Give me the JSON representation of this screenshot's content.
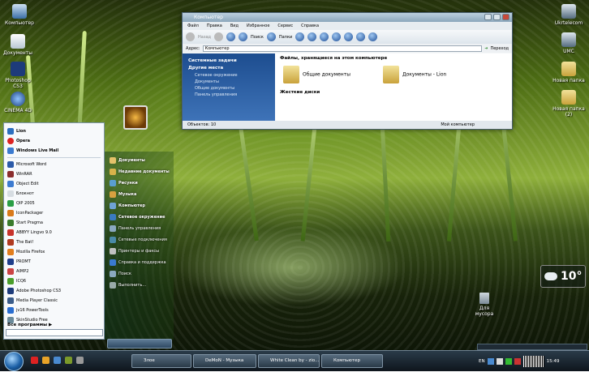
{
  "desktop": {
    "icons_left": [
      {
        "label": "Компьютер"
      },
      {
        "label": "Документы"
      },
      {
        "label": "Photoshop CS3"
      },
      {
        "label": "CINEMA 4D"
      }
    ],
    "icons_right": [
      {
        "label": "Ukrtelecom"
      },
      {
        "label": "UMC"
      },
      {
        "label": "Новая папка"
      },
      {
        "label": "Новая папка (2)"
      }
    ],
    "trash": "Для мусора"
  },
  "window": {
    "title": "Компьютер",
    "menu": [
      "Файл",
      "Правка",
      "Вид",
      "Избранное",
      "Сервис",
      "Справка"
    ],
    "toolbar": {
      "back": "Назад",
      "search": "Поиск",
      "folders": "Папки"
    },
    "address_label": "Адрес:",
    "address_value": "Компьютер",
    "go": "Переход",
    "tasks_system": "Системные задачи",
    "tasks_other": "Другие места",
    "other_places": [
      "Сетевое окружение",
      "Документы",
      "Общие документы",
      "Панель управления"
    ],
    "files_heading": "Файлы, хранящиеся на этом компьютере",
    "folders": [
      "Общие документы",
      "Документы - Lion"
    ],
    "drives_heading": "Жесткие диски",
    "status_left": "Объектов: 10",
    "status_right": "Мой компьютер"
  },
  "start_menu": {
    "pinned": [
      "Lion",
      "Opera",
      "Windows Live Mail"
    ],
    "programs": [
      "Microsoft Word",
      "WinRAR",
      "Object Edit",
      "Блокнот",
      "QIP 2005",
      "IconPackager",
      "Start Pragma",
      "ABBYY Lingvo 9.0",
      "The Bat!",
      "Mozilla Firefox",
      "PROMT",
      "AIMP2",
      "ICQ6",
      "Adobe Photoshop CS3",
      "Media Player Classic",
      "jv16 PowerTools",
      "SkinStudio Free"
    ],
    "all_programs": "Все программы",
    "right": [
      "Документы",
      "Недавние документы",
      "Рисунки",
      "Музыка",
      "Компьютер",
      "Сетевое окружение",
      "Панель управления",
      "Сетевые подключения",
      "Принтеры и факсы",
      "Справка и поддержка",
      "Поиск",
      "Выполнить..."
    ]
  },
  "taskbar": {
    "buttons": [
      "Злое",
      "DeMoN - Музыка",
      "White Clean by - zio...",
      "Компьютер"
    ],
    "lang": "EN",
    "time": "15:49"
  },
  "weather": {
    "temp": "10°"
  }
}
